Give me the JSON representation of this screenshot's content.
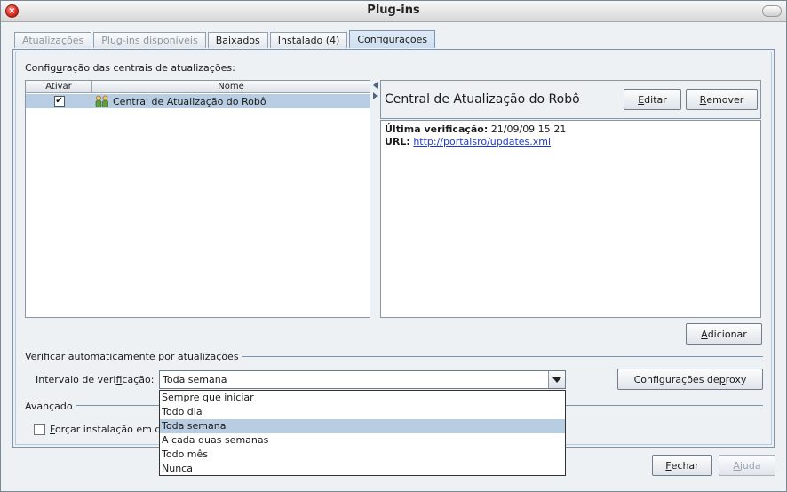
{
  "window": {
    "title": "Plug-ins",
    "close_glyph": "×"
  },
  "tabs": [
    {
      "label": "Atualizações",
      "state": "disabled"
    },
    {
      "label": "Plug-ins disponíveis",
      "state": "disabled"
    },
    {
      "label": "Baixados",
      "state": "normal"
    },
    {
      "label": "Instalado (4)",
      "state": "normal"
    },
    {
      "label": "Configurações",
      "state": "active"
    }
  ],
  "update_centers": {
    "section_label_pre": "Config",
    "section_label_u": "u",
    "section_label_post": "ração das centrais de atualizações:",
    "columns": [
      "Ativar",
      "Nome"
    ],
    "rows": [
      {
        "enabled": true,
        "check_glyph": "✔",
        "icon": "people-icon",
        "name": "Central de Atualização do Robô"
      }
    ]
  },
  "detail": {
    "title": "Central de Atualização do Robô",
    "edit_pre": "",
    "edit_u": "E",
    "edit_post": "ditar",
    "remove_pre": "",
    "remove_u": "R",
    "remove_post": "emover",
    "last_check_label": "Última verificação:",
    "last_check_value": "21/09/09 15:21",
    "url_label": "URL:",
    "url_value": "http://portalsro/updates.xml"
  },
  "add_button": {
    "pre": "",
    "u": "A",
    "post": "dicionar"
  },
  "auto_check": {
    "section_label": "Verificar automaticamente por atualizações",
    "interval_label_pre": "Intervalo de veri",
    "interval_label_u": "f",
    "interval_label_post": "icação:",
    "interval_value": "Toda semana",
    "options": [
      "Sempre que iniciar",
      "Todo dia",
      "Toda semana",
      "A cada duas semanas",
      "Todo mês",
      "Nunca"
    ],
    "selected_index": 2,
    "proxy_pre": "Configurações de ",
    "proxy_u": "p",
    "proxy_post": "roxy"
  },
  "advanced": {
    "section_label": "Avançado",
    "force_pre": "",
    "force_u": "F",
    "force_post": "orçar instalação em di",
    "force_checked": false
  },
  "footer": {
    "close_pre": "",
    "close_u": "F",
    "close_post": "echar",
    "help_pre": "",
    "help_u": "A",
    "help_post": "juda"
  }
}
